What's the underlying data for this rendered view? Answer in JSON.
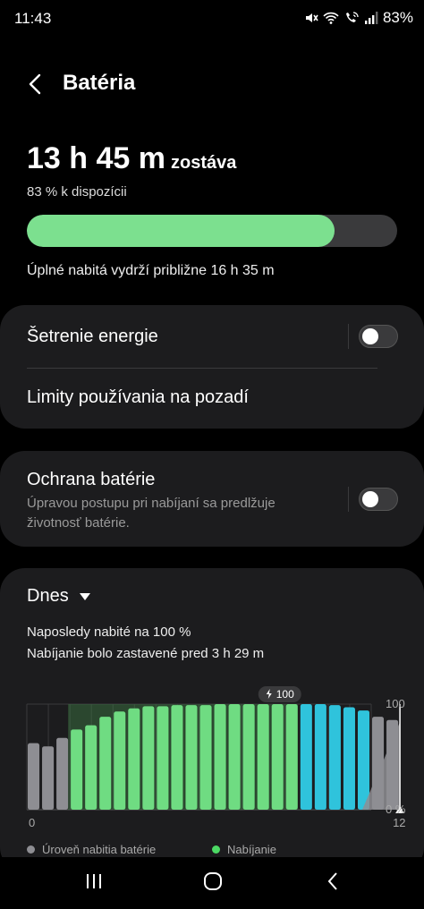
{
  "status_bar": {
    "time": "11:43",
    "battery_percent": "83%"
  },
  "header": {
    "title": "Batéria"
  },
  "summary": {
    "remaining_time": "13 h 45 m",
    "remaining_suffix": "zostáva",
    "available": "83 % k dispozícii",
    "battery_level_percent": 83,
    "full_charge_note": "Úplné nabitá vydrží približne 16 h 35 m"
  },
  "settings": {
    "power_saving": {
      "label": "Šetrenie energie",
      "enabled": false
    },
    "background_limits": {
      "label": "Limity používania na pozadí"
    },
    "battery_protection": {
      "label": "Ochrana batérie",
      "description_line1": "Úpravou postupu pri nabíjaní sa predlžuje",
      "description_line2": "životnosť batérie.",
      "enabled": false
    }
  },
  "usage": {
    "period": "Dnes",
    "last_charged": "Naposledy nabité na 100 %",
    "charging_stopped": "Nabíjanie bolo zastavené pred 3 h 29 m"
  },
  "chart_data": {
    "type": "bar",
    "badge": "100",
    "x_tick_labels": [
      "0",
      "12"
    ],
    "y_tick_labels": [
      "100",
      "0 %"
    ],
    "ylim": [
      0,
      100
    ],
    "bars": [
      {
        "value": 63,
        "kind": "level"
      },
      {
        "value": 60,
        "kind": "level"
      },
      {
        "value": 68,
        "kind": "level"
      },
      {
        "value": 76,
        "kind": "charging"
      },
      {
        "value": 80,
        "kind": "charging"
      },
      {
        "value": 88,
        "kind": "charging"
      },
      {
        "value": 93,
        "kind": "charging"
      },
      {
        "value": 96,
        "kind": "charging"
      },
      {
        "value": 98,
        "kind": "charging"
      },
      {
        "value": 98,
        "kind": "charging"
      },
      {
        "value": 99,
        "kind": "charging"
      },
      {
        "value": 99,
        "kind": "charging"
      },
      {
        "value": 99,
        "kind": "charging"
      },
      {
        "value": 100,
        "kind": "charging"
      },
      {
        "value": 100,
        "kind": "charging"
      },
      {
        "value": 100,
        "kind": "charging"
      },
      {
        "value": 100,
        "kind": "charging"
      },
      {
        "value": 100,
        "kind": "charging"
      },
      {
        "value": 100,
        "kind": "charging"
      },
      {
        "value": 100,
        "kind": "protect"
      },
      {
        "value": 100,
        "kind": "protect"
      },
      {
        "value": 99,
        "kind": "protect"
      },
      {
        "value": 97,
        "kind": "protect"
      },
      {
        "value": 94,
        "kind": "protect"
      },
      {
        "value": 88,
        "kind": "level"
      },
      {
        "value": 85,
        "kind": "level"
      }
    ],
    "projection": {
      "start_value": 83,
      "end_value": 0
    },
    "legend": [
      {
        "label": "Úroveň nabitia batérie",
        "color": "#8e8e93"
      },
      {
        "label": "Nabíjanie",
        "color": "#4cd964"
      }
    ],
    "colors": {
      "level": "#8e8e93",
      "charging": "#6fdc82",
      "protect": "#2fc3dc",
      "projection": "#8e8e93"
    }
  }
}
